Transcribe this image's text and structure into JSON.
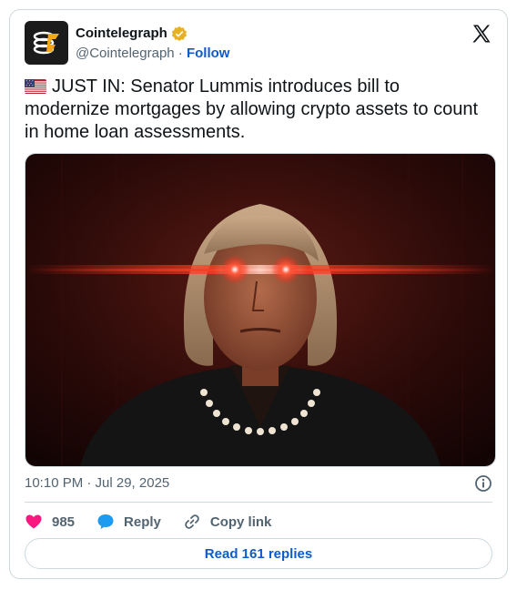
{
  "author": {
    "display_name": "Cointelegraph",
    "handle": "@Cointelegraph",
    "separator": " · ",
    "follow_label": "Follow",
    "verified_color": "#e8b123"
  },
  "tweet": {
    "flag_icon": "us-flag",
    "text": "JUST IN: Senator Lummis introduces bill to modernize mortgages by allowing crypto assets to count in home loan assessments.",
    "timestamp": "10:10 PM · Jul 29, 2025"
  },
  "actions": {
    "like_count": "985",
    "reply_label": "Reply",
    "copy_link_label": "Copy link",
    "read_replies_label": "Read 161 replies"
  },
  "colors": {
    "like": "#f91880",
    "reply": "#1d9bf0",
    "link": "#0f5bc7"
  }
}
